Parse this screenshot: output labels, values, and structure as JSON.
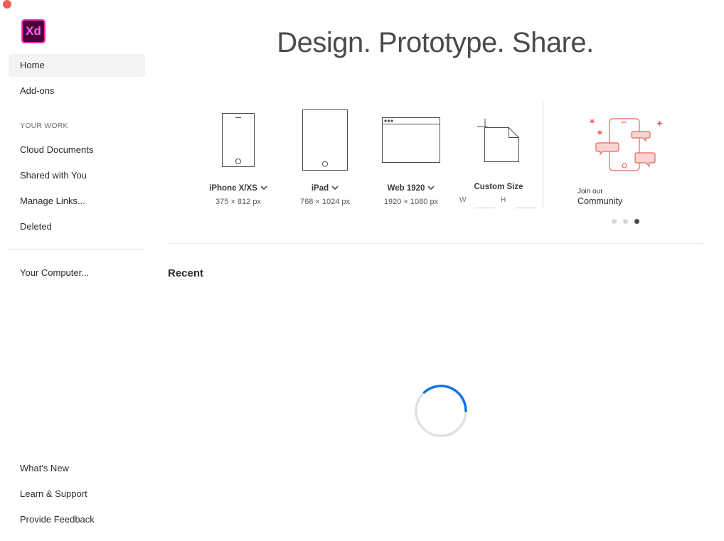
{
  "app": {
    "logo_text": "Xd"
  },
  "sidebar": {
    "top_items": [
      {
        "label": "Home",
        "active": true
      },
      {
        "label": "Add-ons"
      }
    ],
    "section_label": "YOUR WORK",
    "work_items": [
      {
        "label": "Cloud Documents"
      },
      {
        "label": "Shared with You"
      },
      {
        "label": "Manage Links..."
      },
      {
        "label": "Deleted"
      }
    ],
    "computer_item": {
      "label": "Your Computer..."
    },
    "bottom_items": [
      {
        "label": "What's New"
      },
      {
        "label": "Learn & Support"
      },
      {
        "label": "Provide Feedback"
      }
    ]
  },
  "main": {
    "headline": "Design. Prototype. Share.",
    "presets": [
      {
        "name": "iPhone X/XS",
        "size": "375 × 812 px",
        "icon": "phone-icon"
      },
      {
        "name": "iPad",
        "size": "768 × 1024 px",
        "icon": "tablet-icon"
      },
      {
        "name": "Web 1920",
        "size": "1920 × 1080 px",
        "icon": "browser-icon"
      }
    ],
    "custom": {
      "name": "Custom Size",
      "w_label": "W",
      "h_label": "H",
      "w_value": "",
      "h_value": ""
    },
    "community": {
      "line1": "Join our",
      "line2": "Community",
      "carousel_pages": 3,
      "active_page": 3
    },
    "recent_title": "Recent",
    "loading": true
  },
  "colors": {
    "accent": "#1473e6",
    "brand": "#ff61f6",
    "close": "#ee5e57",
    "illustration": "#e8655b"
  }
}
